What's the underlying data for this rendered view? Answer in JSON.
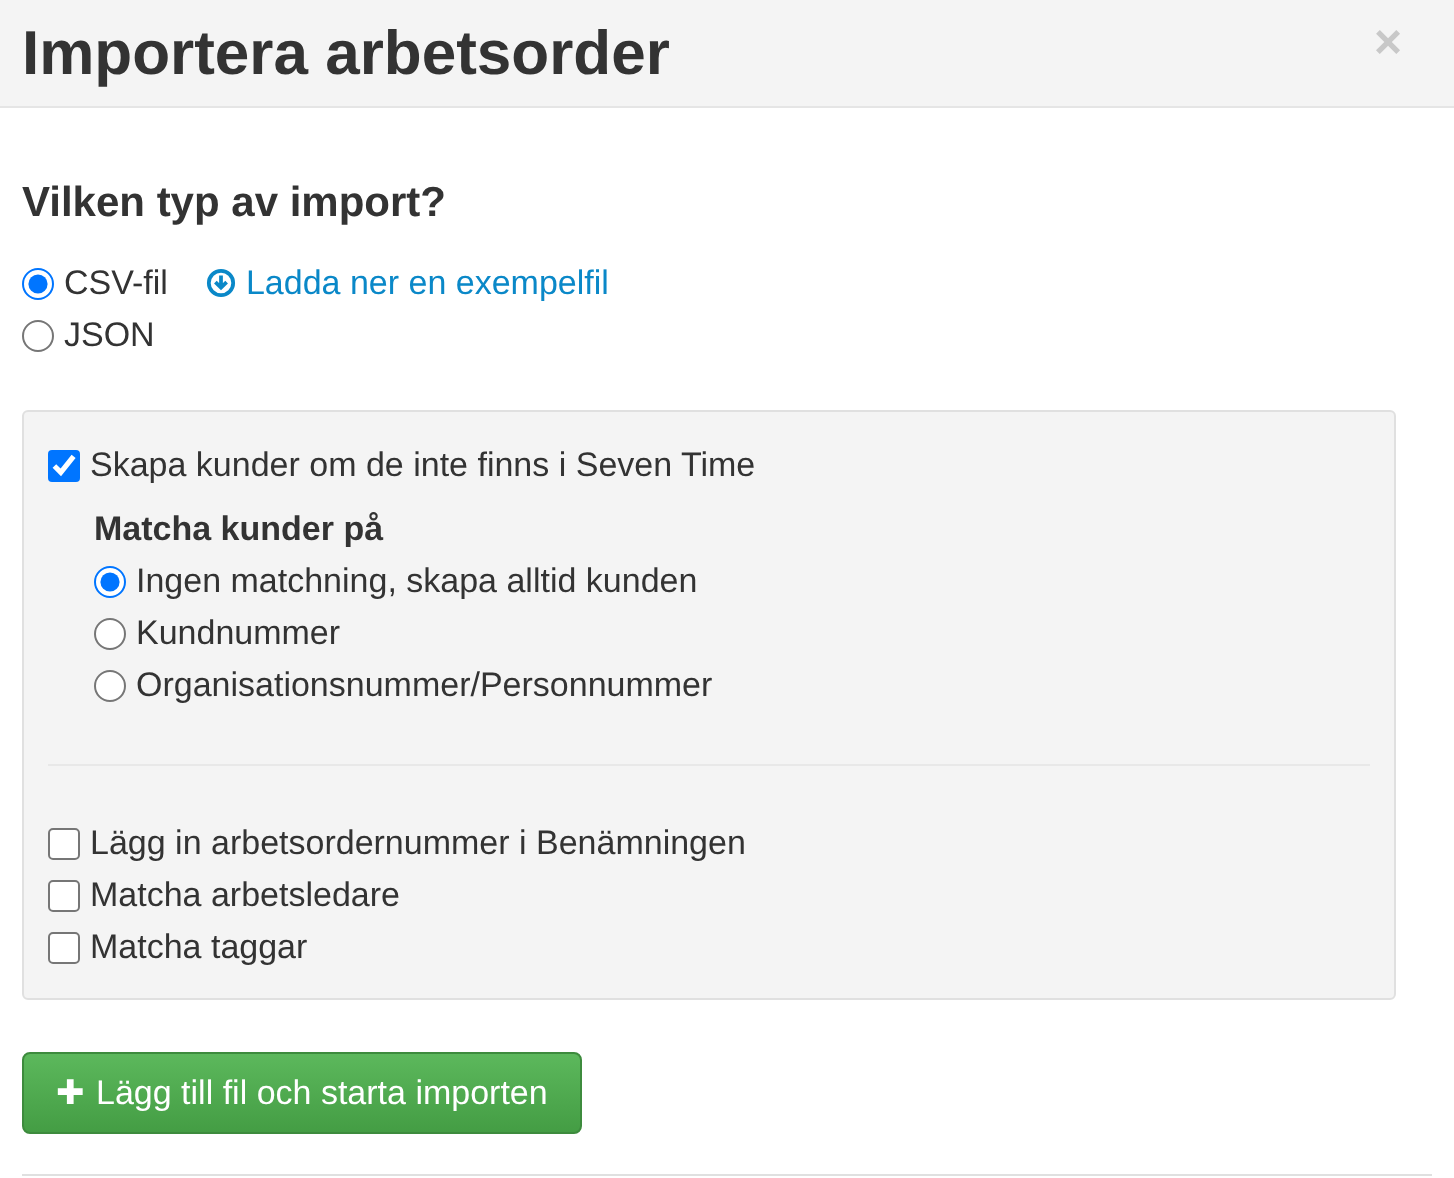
{
  "dialog": {
    "title": "Importera arbetsorder",
    "close": "×"
  },
  "import_type": {
    "heading": "Vilken typ av import?",
    "options": [
      {
        "label": "CSV-fil",
        "selected": true
      },
      {
        "label": "JSON",
        "selected": false
      }
    ],
    "download_link": "Ladda ner en exempelfil"
  },
  "settings": {
    "create_customers": {
      "label": "Skapa kunder om de inte finns i Seven Time",
      "checked": true
    },
    "match_heading": "Matcha kunder på",
    "match_options": [
      {
        "label": "Ingen matchning, skapa alltid kunden",
        "selected": true
      },
      {
        "label": "Kundnummer",
        "selected": false
      },
      {
        "label": "Organisationsnummer/Personnummer",
        "selected": false
      }
    ],
    "checkboxes": [
      {
        "label": "Lägg in arbetsordernummer i Benämningen",
        "checked": false
      },
      {
        "label": "Matcha arbetsledare",
        "checked": false
      },
      {
        "label": "Matcha taggar",
        "checked": false
      }
    ]
  },
  "submit_button": {
    "icon": "✚",
    "label": "Lägg till fil och starta importen"
  }
}
